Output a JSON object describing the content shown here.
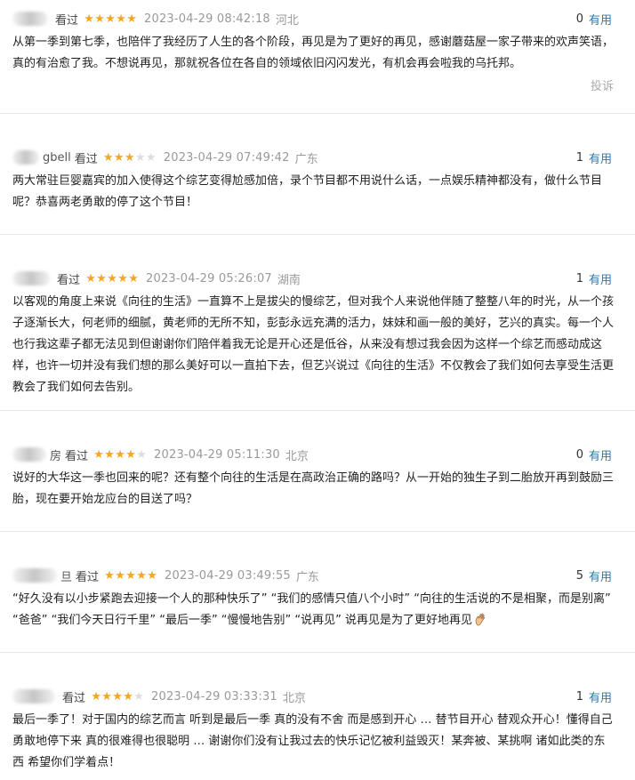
{
  "watched_label": "看过",
  "useful_label": "有用",
  "report_label": "投诉",
  "reviews": [
    {
      "name": "",
      "rating": 5,
      "time": "2023-04-29 08:42:18",
      "location": "河北",
      "votes": "0",
      "content": "从第一季到第七季，也陪伴了我经历了人生的各个阶段，再见是为了更好的再见，感谢蘑菇屋一家子带来的欢声笑语，真的有治愈了我。不想说再见，那就祝各位在各自的领域依旧闪闪发光，有机会再会啦我的乌托邦。"
    },
    {
      "name": "gbell",
      "rating": 3,
      "time": "2023-04-29 07:49:42",
      "location": "广东",
      "votes": "1",
      "content": "两大常驻巨婴嘉宾的加入使得这个综艺变得尬感加倍，录个节目都不用说什么话，一点娱乐精神都没有，做什么节目呢？恭喜两老勇敢的停了这个节目！"
    },
    {
      "name": "",
      "rating": 5,
      "time": "2023-04-29 05:26:07",
      "location": "湖南",
      "votes": "1",
      "content": "以客观的角度上来说《向往的生活》一直算不上是拔尖的慢综艺，但对我个人来说他伴随了整整八年的时光，从一个孩子逐渐长大，何老师的细腻，黄老师的无所不知，彭彭永远充满的活力，妹妹和画一般的美好，艺兴的真实。每一个人也行我这辈子都无法见到但谢谢你们陪伴着我无论是开心还是低谷，从来没有想过我会因为这样一个综艺而感动成这样，也许一切并没有我们想的那么美好可以一直拍下去，但艺兴说过《向往的生活》不仅教会了我们如何去享受生活更教会了我们如何去告别。"
    },
    {
      "name": "房",
      "rating": 4,
      "time": "2023-04-29 05:11:30",
      "location": "北京",
      "votes": "0",
      "content": "说好的大华这一季也回来的呢？还有整个向往的生活是在高政治正确的路吗？从一开始的独生子到二胎放开再到鼓励三胎，现在要开始龙应台的目送了吗？"
    },
    {
      "name": "旦",
      "rating": 5,
      "time": "2023-04-29 03:49:55",
      "location": "广东",
      "votes": "5",
      "content": "“好久没有以小步紧跑去迎接一个人的那种快乐了” “我们的感情只值八个小时” “向往的生活说的不是相聚，而是别离” “爸爸” “我们今天日行千里” “最后一季” “慢慢地告别” “说再见” 说再见是为了更好地再见"
    },
    {
      "name": "",
      "rating": 4,
      "time": "2023-04-29 03:33:31",
      "location": "北京",
      "votes": "1",
      "content": "最后一季了！对于国内的综艺而言 听到是最后一季 真的没有不舍 而是感到开心 … 替节目开心 替观众开心！懂得自己勇敢地停下来 真的很难得也很聪明 … 谢谢你们没有让我过去的快乐记忆被利益毁灭！某奔被、某挑啊 诸如此类的东西 希望你们学着点！"
    }
  ]
}
